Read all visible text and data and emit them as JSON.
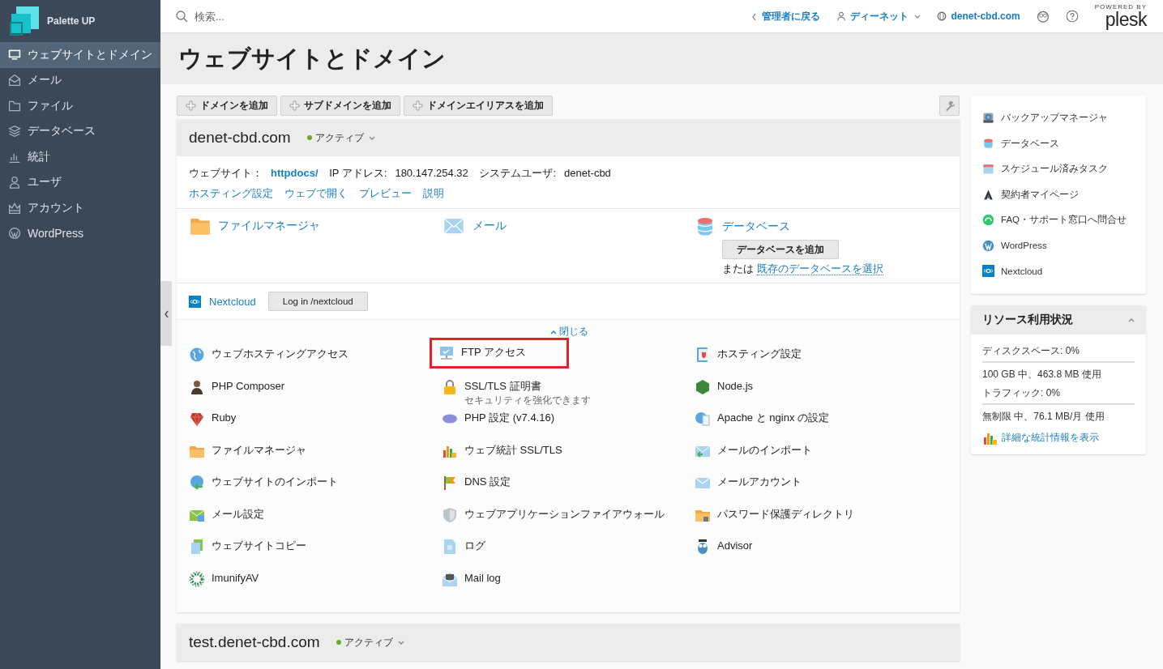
{
  "brand": {
    "name": "Palette UP"
  },
  "sidebar": {
    "items": [
      {
        "label": "ウェブサイトとドメイン",
        "selected": true
      },
      {
        "label": "メール",
        "selected": false
      },
      {
        "label": "ファイル",
        "selected": false
      },
      {
        "label": "データベース",
        "selected": false
      },
      {
        "label": "統計",
        "selected": false
      },
      {
        "label": "ユーザ",
        "selected": false
      },
      {
        "label": "アカウント",
        "selected": false
      },
      {
        "label": "WordPress",
        "selected": false
      }
    ]
  },
  "topbar": {
    "search_placeholder": "検索...",
    "back_link": "管理者に戻る",
    "user": "ディーネット",
    "domain": "denet-cbd.com",
    "logo_caption": "POWERED BY",
    "logo": "plesk"
  },
  "page_title": "ウェブサイトとドメイン",
  "toolbar": {
    "buttons": [
      "ドメインを追加",
      "サブドメインを追加",
      "ドメインエイリアスを追加"
    ]
  },
  "domain": {
    "name": "denet-cbd.com",
    "status": "アクティブ",
    "website_label": "ウェブサイト：",
    "website_link": "httpdocs/",
    "ip_label": "IP アドレス:",
    "ip": "180.147.254.32",
    "user_label": "システムユーザ:",
    "user": "denet-cbd",
    "links": [
      "ホスティング設定",
      "ウェブで開く",
      "プレビュー",
      "説明"
    ],
    "services": [
      {
        "label": "ファイルマネージャ"
      },
      {
        "label": "メール"
      },
      {
        "label": "データベース",
        "button": "データベースを追加",
        "or_text": "または",
        "or_link": "既存のデータベースを選択"
      }
    ],
    "app": {
      "label": "Nextcloud",
      "button": "Log in /nextcloud"
    },
    "collapse": {
      "label": "閉じる",
      "expanded": true
    },
    "tools": [
      {
        "label": "ウェブホスティングアクセス",
        "highlighted": false
      },
      {
        "label": "FTP アクセス",
        "highlighted": true
      },
      {
        "label": "ホスティング設定",
        "highlighted": false
      },
      {
        "label": "PHP Composer",
        "highlighted": false
      },
      {
        "label": "SSL/TLS 証明書",
        "sublabel": "セキュリティを強化できます",
        "highlighted": false
      },
      {
        "label": "Node.js",
        "highlighted": false
      },
      {
        "label": "Ruby",
        "highlighted": false
      },
      {
        "label": "PHP 設定 (v7.4.16)",
        "highlighted": false
      },
      {
        "label": "Apache と nginx の設定",
        "highlighted": false
      },
      {
        "label": "ファイルマネージャ",
        "highlighted": false
      },
      {
        "label": "ウェブ統計 SSL/TLS",
        "highlighted": false
      },
      {
        "label": "メールのインポート",
        "highlighted": false
      },
      {
        "label": "ウェブサイトのインポート",
        "highlighted": false
      },
      {
        "label": "DNS 設定",
        "highlighted": false
      },
      {
        "label": "メールアカウント",
        "highlighted": false
      },
      {
        "label": "メール設定",
        "highlighted": false
      },
      {
        "label": "ウェブアプリケーションファイアウォール",
        "highlighted": false
      },
      {
        "label": "パスワード保護ディレクトリ",
        "highlighted": false
      },
      {
        "label": "ウェブサイトコピー",
        "highlighted": false
      },
      {
        "label": "ログ",
        "highlighted": false
      },
      {
        "label": "Advisor",
        "highlighted": false
      },
      {
        "label": "ImunifyAV",
        "highlighted": false
      },
      {
        "label": "Mail log",
        "highlighted": false
      }
    ]
  },
  "next_domain": {
    "name": "test.denet-cbd.com",
    "status": "アクティブ"
  },
  "quick_links": [
    "バックアップマネージャ",
    "データベース",
    "スケジュール済みタスク",
    "契約者マイページ",
    "FAQ・サポート窓口へ問合せ",
    "WordPress",
    "Nextcloud"
  ],
  "resources": {
    "title": "リソース利用状況",
    "expanded": true,
    "items": [
      {
        "label": "ディスクスペース: 0%",
        "detail": "100 GB 中、463.8 MB 使用"
      },
      {
        "label": "トラフィック: 0%",
        "detail": "無制限 中、76.1 MB/月 使用"
      }
    ],
    "link": "詳細な統計情報を表示"
  }
}
